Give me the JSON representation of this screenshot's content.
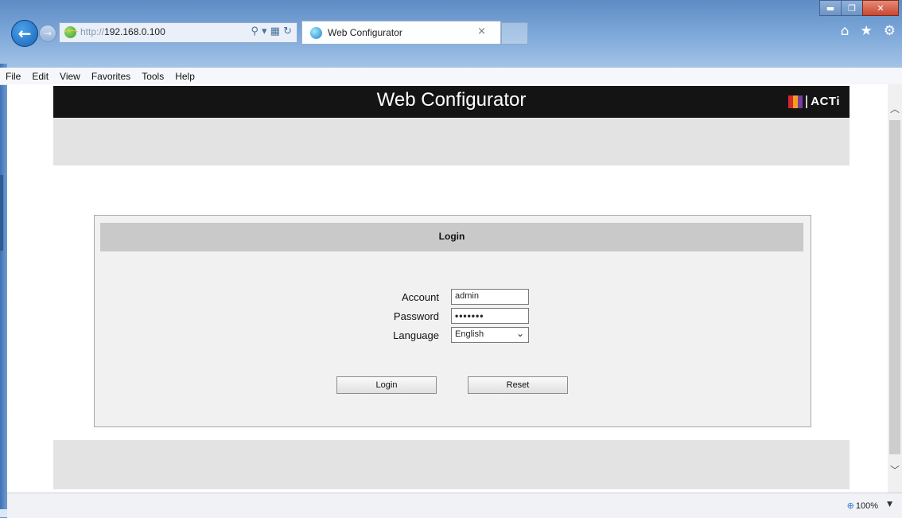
{
  "browser": {
    "url_proto": "http://",
    "url_host": "192.168.0.100",
    "tab_title": "Web Configurator",
    "tab_close": "×",
    "zoom_level": "100%"
  },
  "menu": {
    "items": [
      "File",
      "Edit",
      "View",
      "Favorites",
      "Tools",
      "Help"
    ]
  },
  "page": {
    "banner_title": "Web Configurator",
    "brand": "ACTi"
  },
  "login": {
    "title": "Login",
    "account_label": "Account",
    "account_value": "admin",
    "password_label": "Password",
    "password_mask": "•••••••",
    "language_label": "Language",
    "language_value": "English",
    "login_button": "Login",
    "reset_button": "Reset"
  },
  "icons": {
    "back": "back-arrow-icon",
    "forward": "forward-arrow-icon",
    "home": "home-icon",
    "favorites": "star-icon",
    "tools": "gear-icon"
  }
}
